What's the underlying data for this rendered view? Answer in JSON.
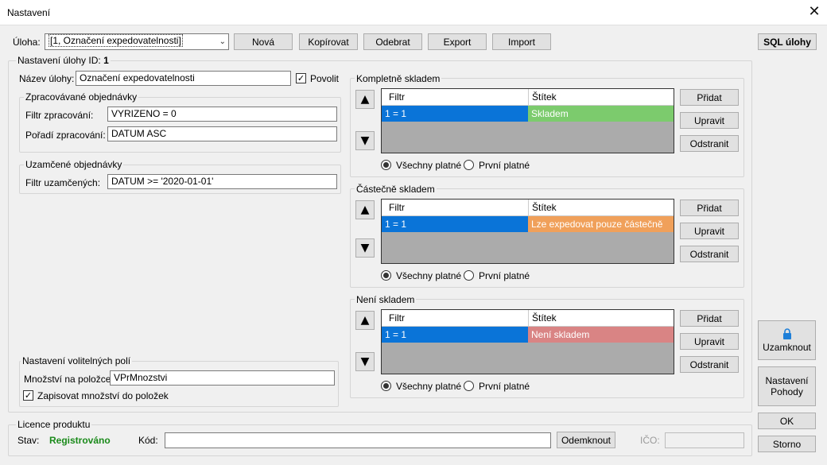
{
  "window": {
    "title": "Nastavení",
    "close_icon": "close-icon"
  },
  "toolbar": {
    "task_label": "Úloha:",
    "task_value": "[1, Označení expedovatelnosti]",
    "new": "Nová",
    "copy": "Kopírovat",
    "remove": "Odebrat",
    "export": "Export",
    "import": "Import",
    "sql": "SQL úlohy"
  },
  "task_settings": {
    "label": "Nastavení úlohy ID:",
    "id": "1",
    "name_label": "Název úlohy:",
    "name_value": "Označení expedovatelnosti",
    "enable_label": "Povolit",
    "enable_checked": true
  },
  "processed_orders": {
    "title": "Zpracovávané objednávky",
    "filter_label": "Filtr zpracování:",
    "filter_value": "VYRIZENO = 0",
    "order_label": "Pořadí zpracování:",
    "order_value": "DATUM ASC"
  },
  "locked_orders": {
    "title": "Uzamčené objednávky",
    "filter_label": "Filtr uzamčených:",
    "filter_value": "DATUM >= '2020-01-01'"
  },
  "optional_fields": {
    "title": "Nastavení volitelných polí",
    "qty_label": "Množství na položce:",
    "qty_value": "VPrMnozstvi",
    "write_qty_label": "Zapisovat množství do položek",
    "write_qty_checked": true
  },
  "stock_groups": [
    {
      "title": "Kompletně skladem",
      "col_filter": "Filtr",
      "col_label": "Štítek",
      "row_filter": "1 = 1",
      "row_label": "Skladem",
      "row_color": "#7ccb6d",
      "add": "Přidat",
      "edit": "Upravit",
      "delete": "Odstranit",
      "all_valid": "Všechny platné",
      "first_valid": "První platné"
    },
    {
      "title": "Částečně skladem",
      "col_filter": "Filtr",
      "col_label": "Štítek",
      "row_filter": "1 = 1",
      "row_label": "Lze expedovat pouze částečně",
      "row_color": "#f0a05a",
      "add": "Přidat",
      "edit": "Upravit",
      "delete": "Odstranit",
      "all_valid": "Všechny platné",
      "first_valid": "První platné"
    },
    {
      "title": "Není skladem",
      "col_filter": "Filtr",
      "col_label": "Štítek",
      "row_filter": "1 = 1",
      "row_label": "Není skladem",
      "row_color": "#d98484",
      "add": "Přidat",
      "edit": "Upravit",
      "delete": "Odstranit",
      "all_valid": "Všechny platné",
      "first_valid": "První platné"
    }
  ],
  "side_buttons": {
    "lock": "Uzamknout",
    "pohoda_line1": "Nastavení",
    "pohoda_line2": "Pohody",
    "ok": "OK",
    "cancel": "Storno"
  },
  "license": {
    "title": "Licence produktu",
    "status_label": "Stav:",
    "status_value": "Registrováno",
    "status_color": "#1a8a1a",
    "code_label": "Kód:",
    "code_value": "",
    "unlock": "Odemknout",
    "ico_label": "IČO:",
    "ico_value": ""
  },
  "colors": {
    "selection": "#0a74d8",
    "grid_bg": "#ababab"
  }
}
